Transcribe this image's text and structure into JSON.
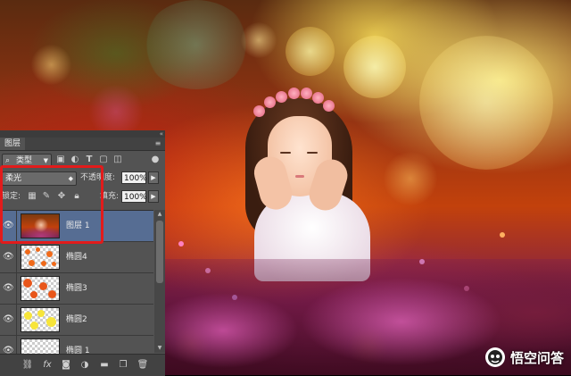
{
  "panel": {
    "tab_title": "图层",
    "filter": {
      "label": "类型"
    },
    "blend_mode": "柔光",
    "opacity": {
      "label": "不透明度:",
      "value": "100%"
    },
    "lock": {
      "label": "锁定:"
    },
    "fill": {
      "label": "填充:",
      "value": "100%"
    },
    "layers": [
      {
        "name": "图层 1",
        "selected": true,
        "thumbnail": "photo"
      },
      {
        "name": "椭圆4",
        "selected": false,
        "thumbnail": "orange-dots"
      },
      {
        "name": "椭圆3",
        "selected": false,
        "thumbnail": "orange-large-dots"
      },
      {
        "name": "椭圆2",
        "selected": false,
        "thumbnail": "yellow-dots"
      },
      {
        "name": "椭圆 1",
        "selected": false,
        "thumbnail": "transparent"
      }
    ],
    "highlight_color": "#e21b1b",
    "selected_row_color": "#566d93"
  },
  "watermark": {
    "text": "悟空问答"
  }
}
